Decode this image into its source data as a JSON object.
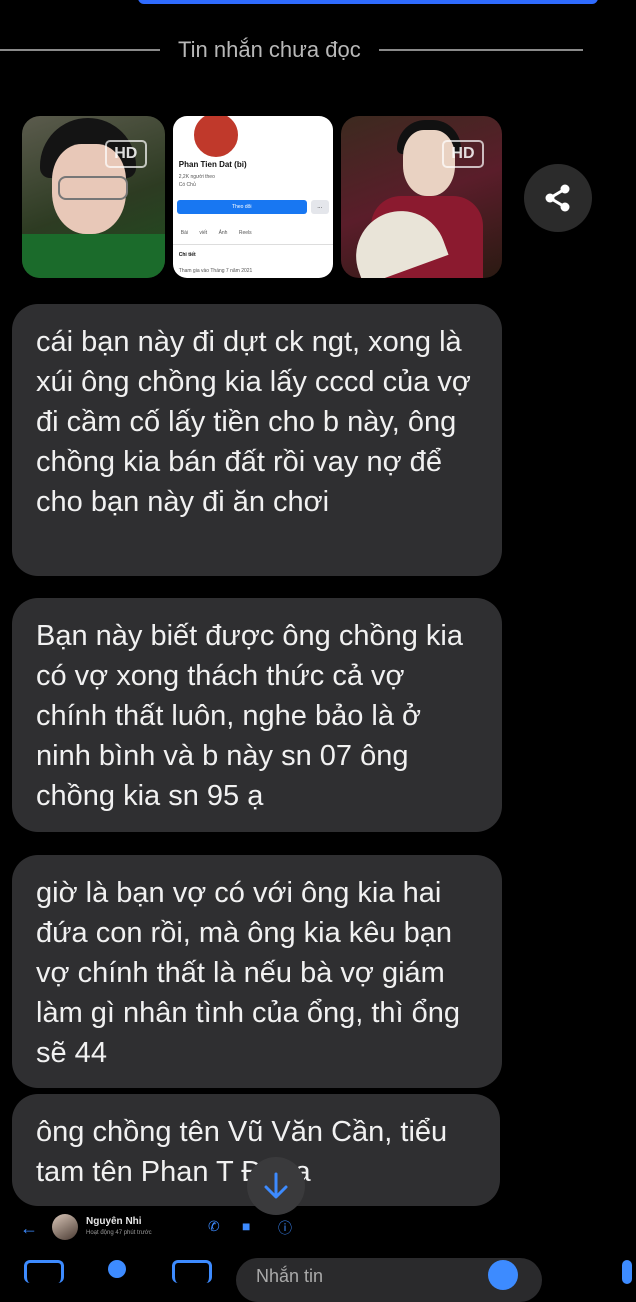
{
  "unread_divider": {
    "label": "Tin nhắn chưa đọc"
  },
  "media": {
    "hd_label": "HD",
    "facebook_preview": {
      "name": "Phan Tien Dat (bi)",
      "followers": "2,2K người theo",
      "status": "Có Chủ",
      "follow_button": "Theo dõi",
      "more_button": "...",
      "tabs": [
        "Bài viết",
        "Ảnh",
        "Reels"
      ],
      "section_title": "Chi tiết",
      "joined": "Tham gia vào Tháng 7 năm 2021"
    }
  },
  "messages": [
    {
      "text": "cái bạn này đi dựt ck ngt, xong là xúi ông chồng kia lấy cccd của vợ đi cầm cố lấy tiền cho b này, ông chồng kia bán đất rồi vay nợ để cho bạn này đi ăn chơi"
    },
    {
      "text": "Bạn này biết được ông chồng kia có vợ xong thách thức cả vợ chính thất luôn, nghe bảo là ở ninh bình và b này sn 07 ông chồng kia sn 95 ạ"
    },
    {
      "text": "giờ là bạn vợ có với ông kia hai đứa con rồi, mà ông kia kêu bạn vợ chính thất là nếu bà vợ giám làm gì nhân tình của ổng, thì ổng sẽ 44"
    },
    {
      "text": "ông chồng tên Vũ Văn Cần, tiểu tam tên Phan T  Đạt ạ"
    }
  ],
  "chat_header": {
    "contact_name": "Nguyên Nhi",
    "status": "Hoạt động 47 phút trước"
  },
  "composer": {
    "placeholder": "Nhắn tin"
  },
  "colors": {
    "accent": "#3d8bff",
    "bubble": "#2f2f31",
    "background": "#000000"
  }
}
